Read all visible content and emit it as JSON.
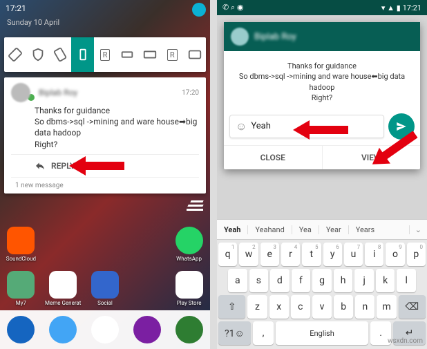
{
  "left": {
    "status": {
      "time": "17:21",
      "date": "Sunday 10 April"
    },
    "notification": {
      "sender": "Biplab Roy",
      "timestamp": "17:20",
      "line1": "Thanks for guidance",
      "line2": "So dbms->sql ->mining and ware house➡big data hadoop",
      "line3": "Right?",
      "reply_label": "REPLY",
      "new_msg": "1 new message"
    },
    "apps_row1": [
      "SoundCloud",
      "",
      "",
      "",
      "WhatsApp"
    ],
    "apps_row2": [
      "My7",
      "Meme Generat",
      "Social",
      "",
      "Play Store"
    ]
  },
  "right": {
    "status": {
      "time": "17:21"
    },
    "popup": {
      "sender": "Biplab Roy",
      "line1": "Thanks for guidance",
      "line2": "So dbms->sql ->mining and ware house⬅big data hadoop",
      "line3": "Right?",
      "input_value": "Yeah",
      "close_label": "CLOSE",
      "view_label": "VIEW"
    },
    "keyboard": {
      "suggestions": [
        "Yeah",
        "Yeahand",
        "Yea",
        "Year",
        "Years"
      ],
      "row1": [
        "q",
        "w",
        "e",
        "r",
        "t",
        "y",
        "u",
        "i",
        "o",
        "p"
      ],
      "row1nums": [
        "1",
        "2",
        "3",
        "4",
        "5",
        "6",
        "7",
        "8",
        "9",
        "0"
      ],
      "row2": [
        "a",
        "s",
        "d",
        "f",
        "g",
        "h",
        "j",
        "k",
        "l"
      ],
      "row3": [
        "z",
        "x",
        "c",
        "v",
        "b",
        "n",
        "m"
      ],
      "sym": "?1☺",
      "comma": ",",
      "space": "English",
      "period": ".",
      "enter": "↵"
    }
  },
  "watermark": "wsxdn.com"
}
